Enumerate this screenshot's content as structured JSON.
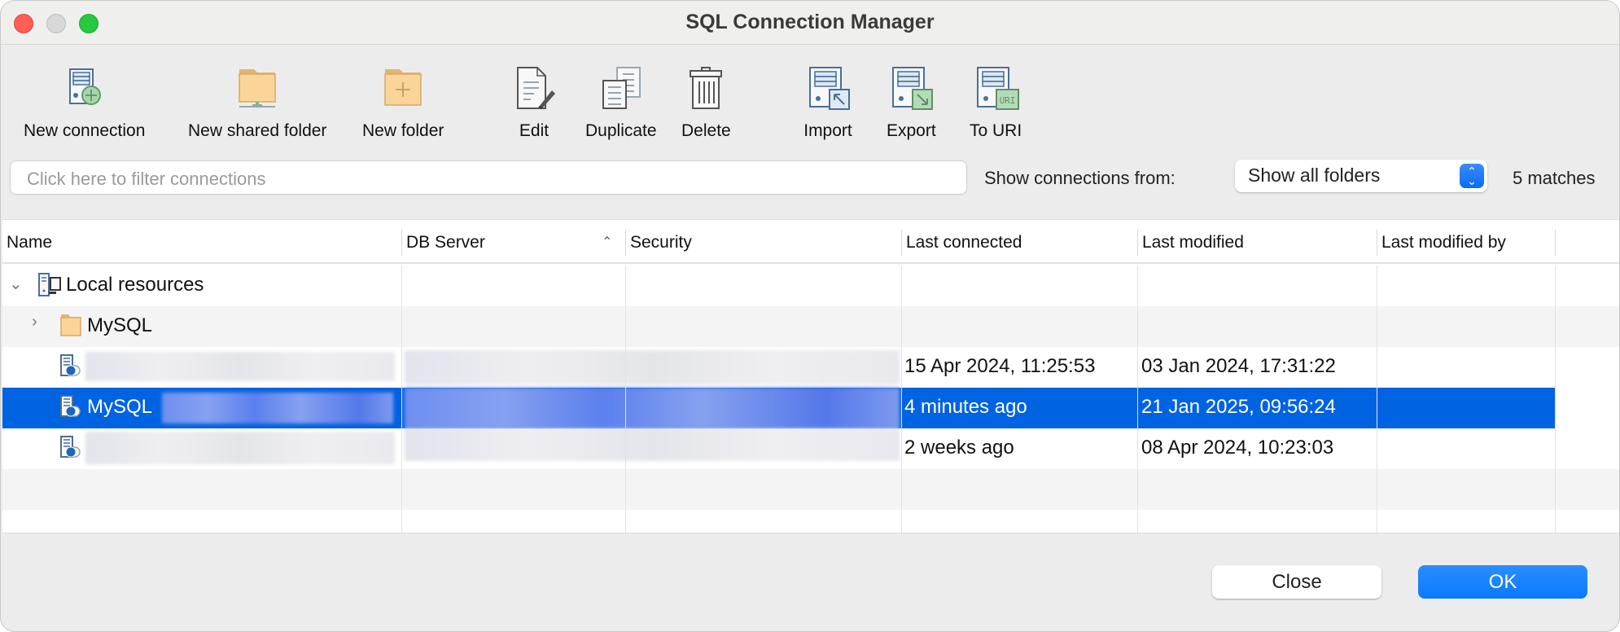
{
  "window": {
    "title": "SQL Connection Manager"
  },
  "toolbar": {
    "items": [
      {
        "id": "new-connection",
        "label": "New connection",
        "icon": "server-add-icon"
      },
      {
        "id": "new-shared-folder",
        "label": "New shared folder",
        "icon": "shared-folder-icon"
      },
      {
        "id": "new-folder",
        "label": "New folder",
        "icon": "folder-add-icon"
      },
      {
        "id": "edit",
        "label": "Edit",
        "icon": "edit-document-icon"
      },
      {
        "id": "duplicate",
        "label": "Duplicate",
        "icon": "duplicate-icon"
      },
      {
        "id": "delete",
        "label": "Delete",
        "icon": "trash-icon"
      },
      {
        "id": "import",
        "label": "Import",
        "icon": "import-icon"
      },
      {
        "id": "export",
        "label": "Export",
        "icon": "export-icon"
      },
      {
        "id": "to-uri",
        "label": "To URI",
        "icon": "uri-icon"
      }
    ]
  },
  "filter": {
    "placeholder": "Click here to filter connections",
    "value": ""
  },
  "show_from": {
    "label": "Show connections from:",
    "selected": "Show all folders",
    "matches": "5 matches"
  },
  "table": {
    "columns": [
      "Name",
      "DB Server",
      "Security",
      "Last connected",
      "Last modified",
      "Last modified by"
    ],
    "sorted_column": "DB Server",
    "sort_direction": "ascending",
    "rows": [
      {
        "type": "group",
        "name": "Local resources",
        "expanded": true,
        "icon": "local-resources-icon"
      },
      {
        "type": "folder",
        "name": "MySQL",
        "expanded": false,
        "icon": "folder-icon"
      },
      {
        "type": "connection",
        "name": "",
        "name_redacted": true,
        "db_server_redacted": true,
        "last_connected": "15 Apr 2024, 11:25:53",
        "last_modified": "03 Jan 2024, 17:31:22",
        "last_modified_by": ""
      },
      {
        "type": "connection",
        "name": "MySQL",
        "name_redacted": true,
        "db_server_redacted": true,
        "selected": true,
        "last_connected": "4 minutes ago",
        "last_modified": "21 Jan 2025, 09:56:24",
        "last_modified_by": ""
      },
      {
        "type": "connection",
        "name": "",
        "name_redacted": true,
        "db_server_redacted": true,
        "last_connected": "2 weeks ago",
        "last_modified": "08 Apr 2024, 10:23:03",
        "last_modified_by": ""
      }
    ]
  },
  "buttons": {
    "close": "Close",
    "ok": "OK"
  },
  "colors": {
    "accent": "#0a7aff",
    "selection": "#0063e1",
    "close_traffic": "#fe5f57",
    "max_traffic": "#28c840"
  }
}
